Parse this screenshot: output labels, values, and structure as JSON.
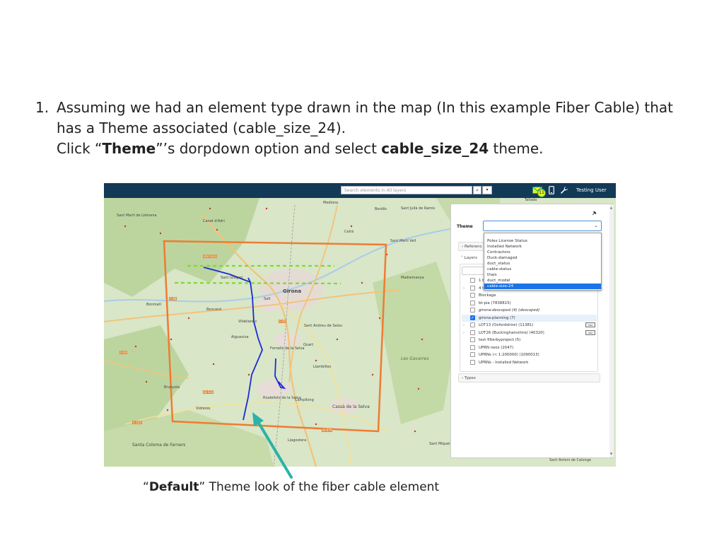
{
  "instructions": {
    "number": "1.",
    "line1": "Assuming we had an element type drawn in the map (In this example Fiber Cable) that",
    "line2": "has a Theme associated (cable_size_24).",
    "line3_pre": "Click “",
    "line3_bold1": "Theme",
    "line3_mid": "”’s dorpdown option and select ",
    "line3_bold2": "cable_size_24",
    "line3_post": " theme."
  },
  "app": {
    "search_placeholder": "Search elements in All layers",
    "search_button_icon": "search-icon",
    "notification_count": "11",
    "user_name": "Testing User"
  },
  "map_labels": {
    "places": [
      "Sant Martí de Llémena",
      "Canet d'Adri",
      "Sant Gregori",
      "Girona",
      "Salt",
      "Bescanó",
      "Bonmatí",
      "Vilablareix",
      "Aiguaviva",
      "Quart",
      "Sant Andreu de Salou",
      "Fornells de la Selva",
      "Llambilles",
      "Les Gavarres",
      "Bordils",
      "Sant Julià de Ramis",
      "Celrà",
      "Sant Martí Vell",
      "Madremanya",
      "Brunyola",
      "Campllong",
      "Vidreres",
      "Riudellots de la Selva",
      "Cassà de la Selva",
      "Santa Coloma de Farners",
      "Llagostera",
      "Sant Miquel de Solterra",
      "Sant Antoni de Calonge",
      "Mediona",
      "Tallada"
    ],
    "roads": [
      "GIV-5313",
      "C-65",
      "C-63",
      "GI-533",
      "C-152",
      "GI-674",
      "C-66"
    ]
  },
  "panel": {
    "theme_label": "Theme",
    "theme_value": "",
    "theme_options": [
      "Poles License Status",
      "Installed Network",
      "Contractors",
      "Duck-damaged",
      "duct_status",
      "cable-status",
      "thais",
      "duct_model",
      "cable-size-24"
    ],
    "selected_option": "cable-size-24",
    "reference_label": "Referenc",
    "layers_label": "Layers",
    "layers": [
      {
        "name": "1 t",
        "caret": false,
        "checked": false,
        "italic": false
      },
      {
        "name": "4 test (1)",
        "caret": true,
        "checked": false,
        "italic": false
      },
      {
        "name": "Blockage",
        "caret": false,
        "checked": false,
        "italic": false
      },
      {
        "name": "bt-pia (7838815)",
        "caret": false,
        "checked": false,
        "italic": false
      },
      {
        "name": "girona-descoped (4) (descoped)",
        "caret": false,
        "checked": false,
        "italic": true
      },
      {
        "name": "girona-planning (7)",
        "caret": false,
        "checked": true,
        "italic": false
      },
      {
        "name": "LOT13 (Oxfordshire) (11381)",
        "caret": true,
        "checked": false,
        "italic": false
      },
      {
        "name": "LOT26 (Buckinghamshire) (40320)",
        "caret": true,
        "checked": false,
        "italic": false
      },
      {
        "name": "test filterbyproject (5)",
        "caret": false,
        "checked": false,
        "italic": false
      },
      {
        "name": "UPRN neos (2047)",
        "caret": false,
        "checked": false,
        "italic": false
      },
      {
        "name": "UPRNs (< 1:200000) (1090013)",
        "caret": false,
        "checked": false,
        "italic": false
      },
      {
        "name": "UPRNs - Installed Network",
        "caret": false,
        "checked": false,
        "italic": false
      }
    ],
    "types_label": "Types"
  },
  "colors": {
    "topbar": "#123a57",
    "selection": "#1a73e8",
    "project_boundary": "#f07b31",
    "cable": "#1a2bd6",
    "dashed_lines": "#7ddc2e",
    "arrow": "#2ab3a6"
  },
  "caption": {
    "open_quote": "“",
    "bold": "Default",
    "rest": "” Theme look of the fiber cable element"
  }
}
